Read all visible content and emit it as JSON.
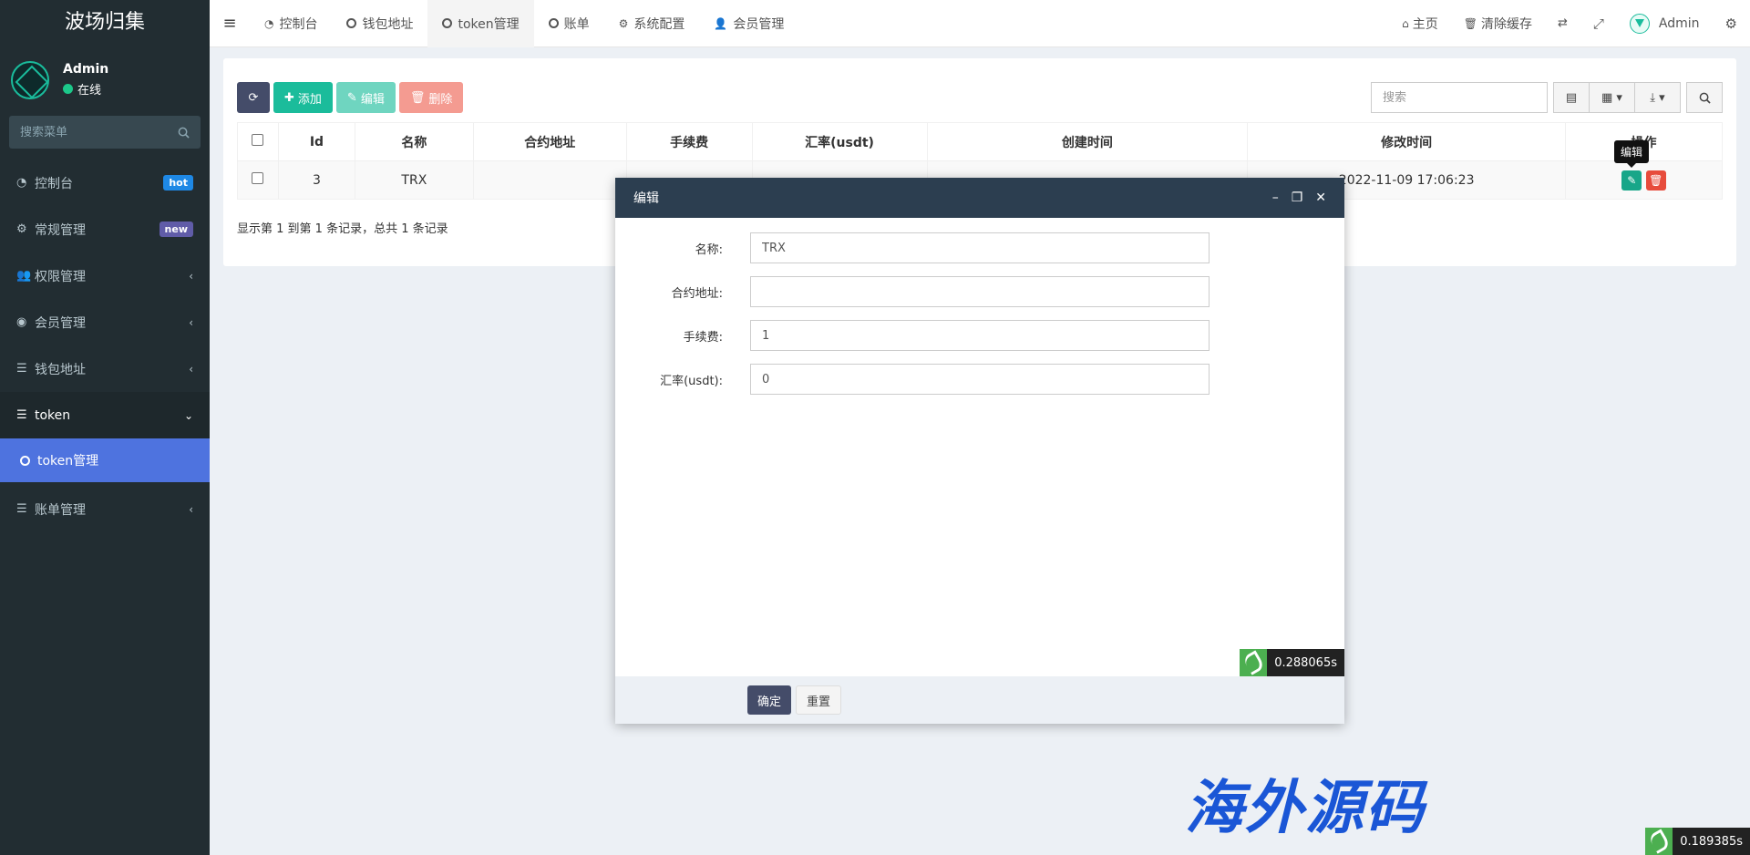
{
  "sidebar": {
    "brand": "波场归集",
    "user": {
      "name": "Admin",
      "status": "在线"
    },
    "search_placeholder": "搜索菜单",
    "items": [
      {
        "label": "控制台",
        "badge": "hot"
      },
      {
        "label": "常规管理",
        "badge": "new"
      },
      {
        "label": "权限管理"
      },
      {
        "label": "会员管理"
      },
      {
        "label": "钱包地址"
      },
      {
        "label": "token"
      },
      {
        "label": "token管理"
      },
      {
        "label": "账单管理"
      }
    ]
  },
  "topnav": {
    "tabs": [
      "控制台",
      "钱包地址",
      "token管理",
      "账单",
      "系统配置",
      "会员管理"
    ],
    "right": {
      "home": "主页",
      "clear_cache": "清除缓存",
      "user": "Admin"
    }
  },
  "toolbar": {
    "add": "添加",
    "edit": "编辑",
    "delete": "删除",
    "search_placeholder": "搜索"
  },
  "table": {
    "headers": [
      "Id",
      "名称",
      "合约地址",
      "手续费",
      "汇率(usdt)",
      "创建时间",
      "修改时间",
      "操作"
    ],
    "rows": [
      {
        "id": "3",
        "name": "TRX",
        "address": "",
        "fee": "",
        "rate": "",
        "created": "",
        "updated": "2022-11-09 17:06:23"
      }
    ],
    "pager": "显示第 1 到第 1 条记录，总共 1 条记录"
  },
  "tooltip": "编辑",
  "modal": {
    "title": "编辑",
    "fields": [
      {
        "label": "名称:",
        "value": "TRX"
      },
      {
        "label": "合约地址:",
        "value": ""
      },
      {
        "label": "手续费:",
        "value": "1"
      },
      {
        "label": "汇率(usdt):",
        "value": "0"
      }
    ],
    "confirm": "确定",
    "reset": "重置"
  },
  "timing": {
    "modal": "0.288065s",
    "page": "0.189385s"
  },
  "watermark": "海外源码"
}
